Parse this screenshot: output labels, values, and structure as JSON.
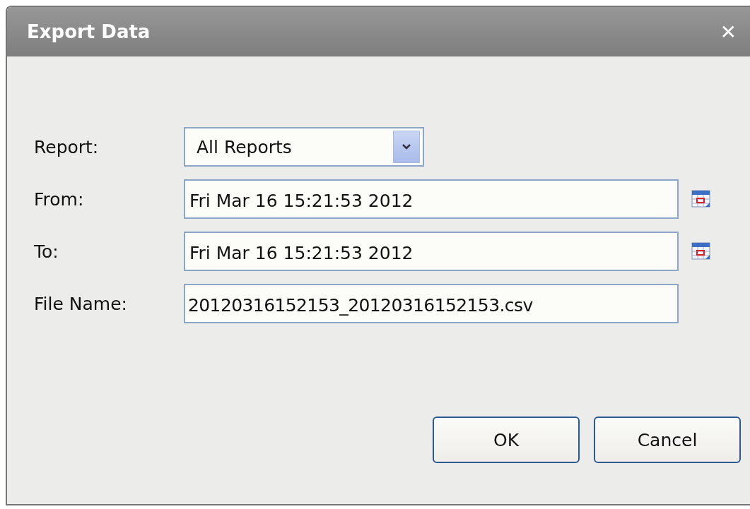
{
  "window": {
    "title": "Export Data",
    "close": "✕"
  },
  "fields": [
    {
      "kind": "select",
      "label": "Report:",
      "value": "All Reports"
    },
    {
      "kind": "date",
      "label": "From:",
      "value": "Fri Mar 16 15:21:53 2012"
    },
    {
      "kind": "date",
      "label": "To:",
      "value": "Fri Mar 16 15:21:53 2012"
    },
    {
      "kind": "text",
      "label": "File Name:",
      "value": "20120316152153_20120316152153.csv"
    }
  ],
  "buttons": [
    "OK",
    "Cancel"
  ]
}
